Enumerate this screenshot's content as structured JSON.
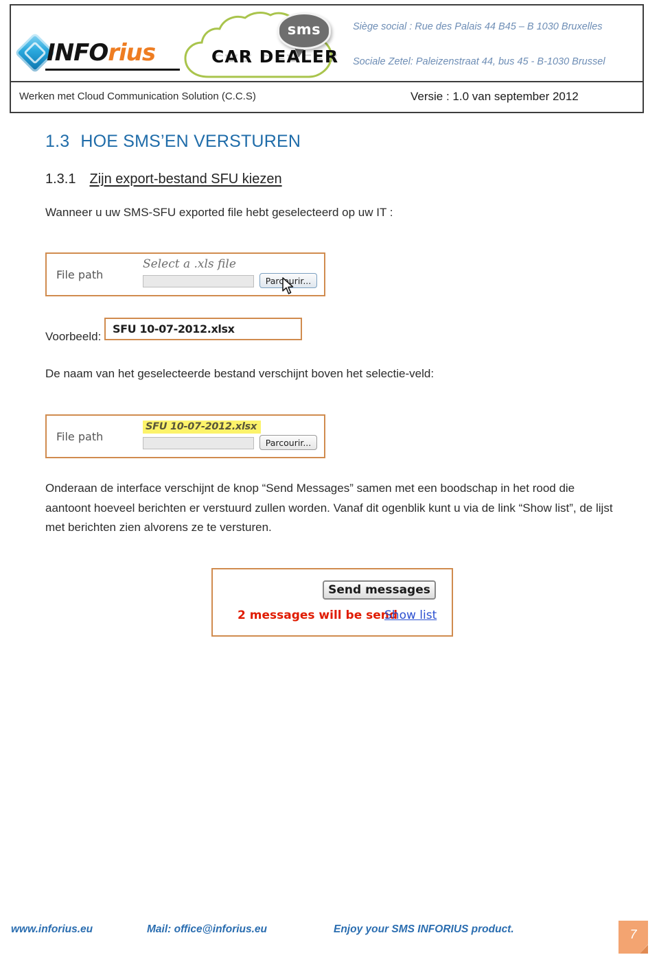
{
  "header": {
    "logo_inforius": {
      "part_black": "INFO",
      "part_orange": "rius"
    },
    "logo_cloud": {
      "brand": "CAR DEALER",
      "badge": "sms"
    },
    "address_fr": "Siège social : Rue des Palais 44 B45 – B 1030 Bruxelles",
    "address_nl": "Sociale Zetel: Paleizenstraat 44, bus 45 - B-1030 Brussel",
    "doc_title": "Werken met Cloud Communication Solution (C.C.S)",
    "version": "Versie : 1.0 van september 2012"
  },
  "content": {
    "section_number": "1.3",
    "section_title_big": "H",
    "section_title_rest": "OE ",
    "section_title_full_1": "HOE ",
    "section_title_full_2": "SMS’",
    "section_title_full_3": "EN ",
    "section_title_full_4": "VERSTUREN",
    "section_title_plain": "HOE SMS’EN VERSTUREN",
    "sub_number": "1.3.1",
    "sub_title": "Zijn export-bestand SFU kiezen",
    "intro_paragraph": "Wanneer u uw SMS-SFU exported file hebt geselecteerd op uw IT :",
    "voorbeeld_label": "Voorbeeld:",
    "desc_paragraph": "De naam van het geselecteerde bestand verschijnt boven het selectie-veld:",
    "long_paragraph": "Onderaan de interface verschijnt de knop “Send Messages” samen met een boodschap in het rood die aantoont hoeveel berichten er verstuurd zullen worden. Vanaf dit  ogenblik kunt u via de link “Show list”, de lijst met berichten zien alvorens ze te versturen."
  },
  "screenshot_filepath_empty": {
    "label": "File path",
    "hint": "Select a .xls file",
    "input_value": "",
    "browse_button": "Parcourir..."
  },
  "screenshot_voorbeeld": {
    "filename": "SFU 10-07-2012.xlsx"
  },
  "screenshot_filepath_filled": {
    "label": "File path",
    "filename_highlighted": "SFU 10-07-2012.xlsx",
    "input_value": "",
    "browse_button": "Parcourir..."
  },
  "screenshot_send": {
    "send_button": "Send messages",
    "count_message": "2 messages will be send",
    "show_list_link": "Show list"
  },
  "footer": {
    "website": "www.inforius.eu",
    "mail": "Mail: office@inforius.eu",
    "slogan": "Enjoy your SMS INFORIUS product.",
    "page_number": "7"
  },
  "colors": {
    "heading_blue": "#1f6ca9",
    "accent_orange": "#d08b4e",
    "brand_orange": "#ee7d22",
    "cloud_green": "#a9c44c",
    "alert_red": "#e01b00",
    "link_blue": "#2b4fd0",
    "footer_blue": "#2a6db0",
    "highlight_yellow": "#fcf36a"
  }
}
